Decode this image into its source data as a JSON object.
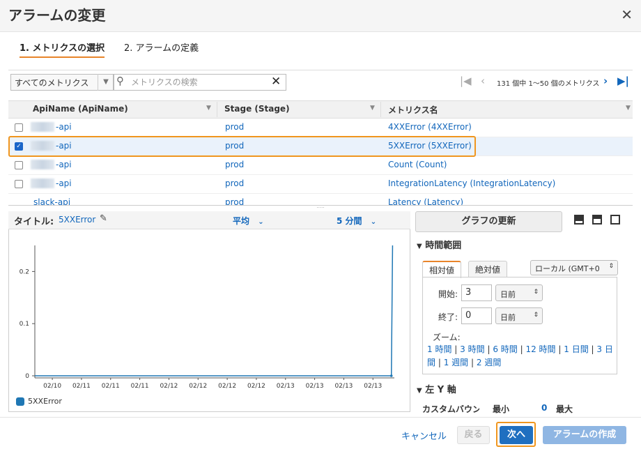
{
  "dialog": {
    "title": "アラームの変更"
  },
  "steps": [
    {
      "label": "1. メトリクスの選択"
    },
    {
      "label": "2. アラームの定義"
    }
  ],
  "toolbar": {
    "filter_value": "すべてのメトリクス",
    "search_placeholder": "メトリクスの検索",
    "pager_text": "131 個中 1〜50 個のメトリクス"
  },
  "table": {
    "columns": [
      "ApiName (ApiName)",
      "Stage (Stage)",
      "メトリクス名"
    ],
    "rows": [
      {
        "api_suffix": "-api",
        "stage": "prod",
        "metric": "4XXError (4XXError)",
        "checked": false
      },
      {
        "api_suffix": "-api",
        "stage": "prod",
        "metric": "5XXError (5XXError)",
        "checked": true
      },
      {
        "api_suffix": "-api",
        "stage": "prod",
        "metric": "Count (Count)",
        "checked": false
      },
      {
        "api_suffix": "-api",
        "stage": "prod",
        "metric": "IntegrationLatency (IntegrationLatency)",
        "checked": false
      },
      {
        "api_suffix": "slack-api",
        "stage": "prod",
        "metric": "Latency (Latency)",
        "checked": false
      }
    ]
  },
  "graph": {
    "title_label": "タイトル:",
    "title": "5XXError",
    "statistic": "平均",
    "period": "5 分間",
    "legend": "5XXError"
  },
  "chart_data": {
    "type": "line",
    "x": [
      "02/10",
      "02/11",
      "02/11",
      "02/11",
      "02/12",
      "02/12",
      "02/12",
      "02/12",
      "02/13",
      "02/13",
      "02/13",
      "02/13"
    ],
    "series": [
      {
        "name": "5XXError",
        "points": [
          [
            0,
            0
          ],
          [
            12.0,
            0
          ],
          [
            12.04,
            0.25
          ]
        ]
      }
    ],
    "xlabel": "",
    "ylabel": "",
    "ylim": [
      0,
      0.25
    ],
    "yticks": [
      "0",
      "0.1",
      "0.2"
    ],
    "x_range": [
      0,
      12.1
    ],
    "legend_position": "bottom-left",
    "color": "#1f77b4"
  },
  "side": {
    "update_button": "グラフの更新",
    "time_range_title": "時間範囲",
    "tab_relative": "相対値",
    "tab_absolute": "絶対値",
    "timezone": "ローカル (GMT+0",
    "start_label": "開始:",
    "start_value": "3",
    "start_unit": "日前",
    "end_label": "終了:",
    "end_value": "0",
    "end_unit": "日前",
    "zoom_label": "ズーム:",
    "zoom_links": [
      "1 時間",
      "3 時間",
      "6 時間",
      "12 時間",
      "1 日間",
      "3 日間",
      "1 週間",
      "2 週間"
    ],
    "yaxis_title": "左 Y 軸",
    "custom_bound_label": "カスタムバウンド",
    "min_label": "最小",
    "min_value": "0",
    "max_label": "最大"
  },
  "footer": {
    "cancel": "キャンセル",
    "back": "戻る",
    "next": "次へ",
    "create": "アラームの作成"
  }
}
